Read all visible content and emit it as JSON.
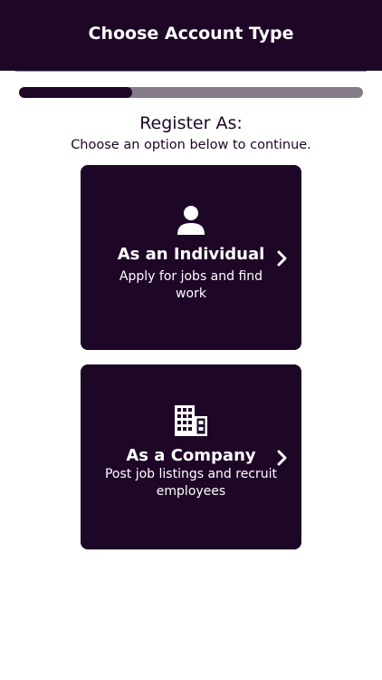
{
  "header": {
    "title": "Choose Account Type"
  },
  "progress": {
    "value_fraction": 0.33
  },
  "main": {
    "heading": "Register As:",
    "subheading": "Choose an option below to continue."
  },
  "options": [
    {
      "title": "As an Individual",
      "description": "Apply for jobs and find work",
      "icon": "person-icon"
    },
    {
      "title": "As a Company",
      "description": "Post job listings and recruit employees",
      "icon": "building-icon"
    }
  ],
  "colors": {
    "primary": "#1e0627",
    "track": "#857b89",
    "background": "#ffffff",
    "card_text": "#ffffff"
  }
}
